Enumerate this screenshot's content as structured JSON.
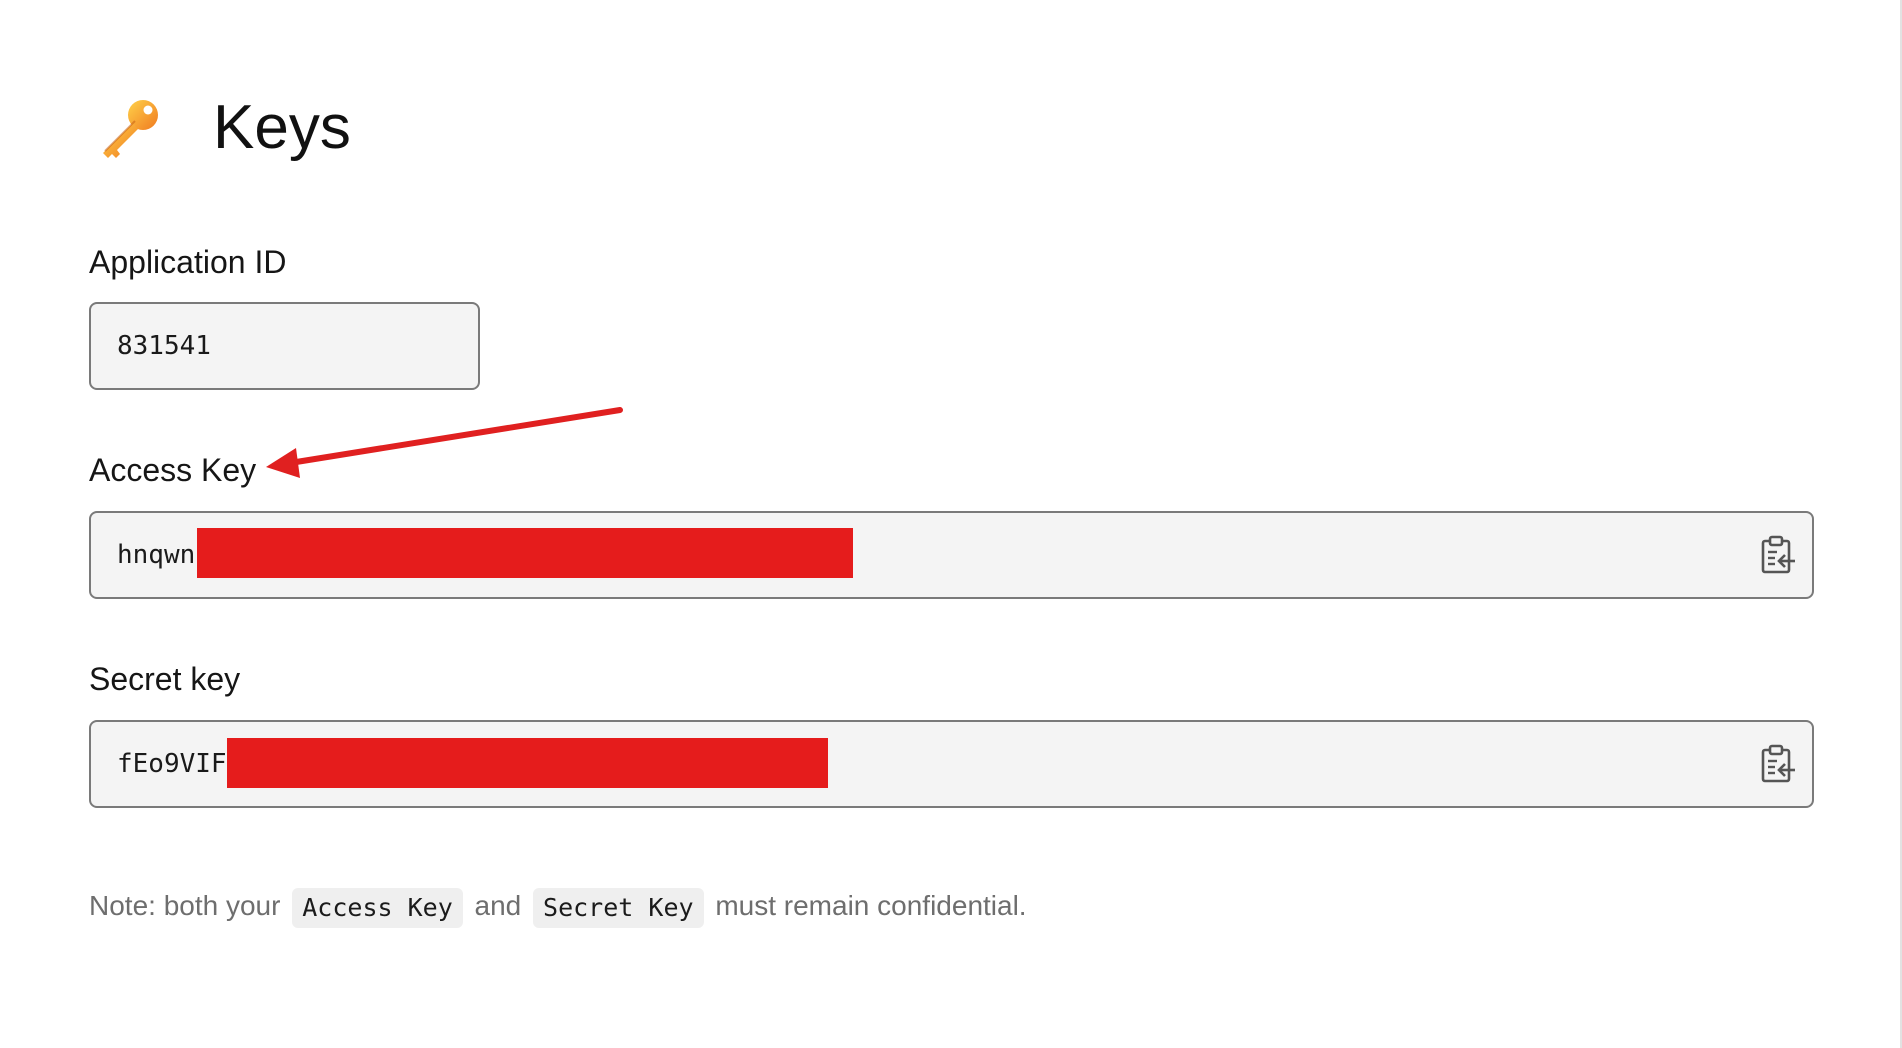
{
  "header": {
    "icon": "key-icon",
    "title": "Keys"
  },
  "fields": {
    "application_id": {
      "label": "Application ID",
      "value": "831541"
    },
    "access_key": {
      "label": "Access Key",
      "value": "hnqwn",
      "copy_icon": "clipboard-copy-icon"
    },
    "secret_key": {
      "label": "Secret key",
      "value": "fEo9VIF",
      "copy_icon": "clipboard-copy-icon"
    }
  },
  "note": {
    "prefix": "Note: both your",
    "code1": "Access Key",
    "middle": "and",
    "code2": "Secret Key",
    "suffix": "must remain confidential."
  },
  "colors": {
    "redaction": "#e51c1c",
    "annotation_arrow": "#e02020",
    "field_background": "#f4f4f4"
  }
}
